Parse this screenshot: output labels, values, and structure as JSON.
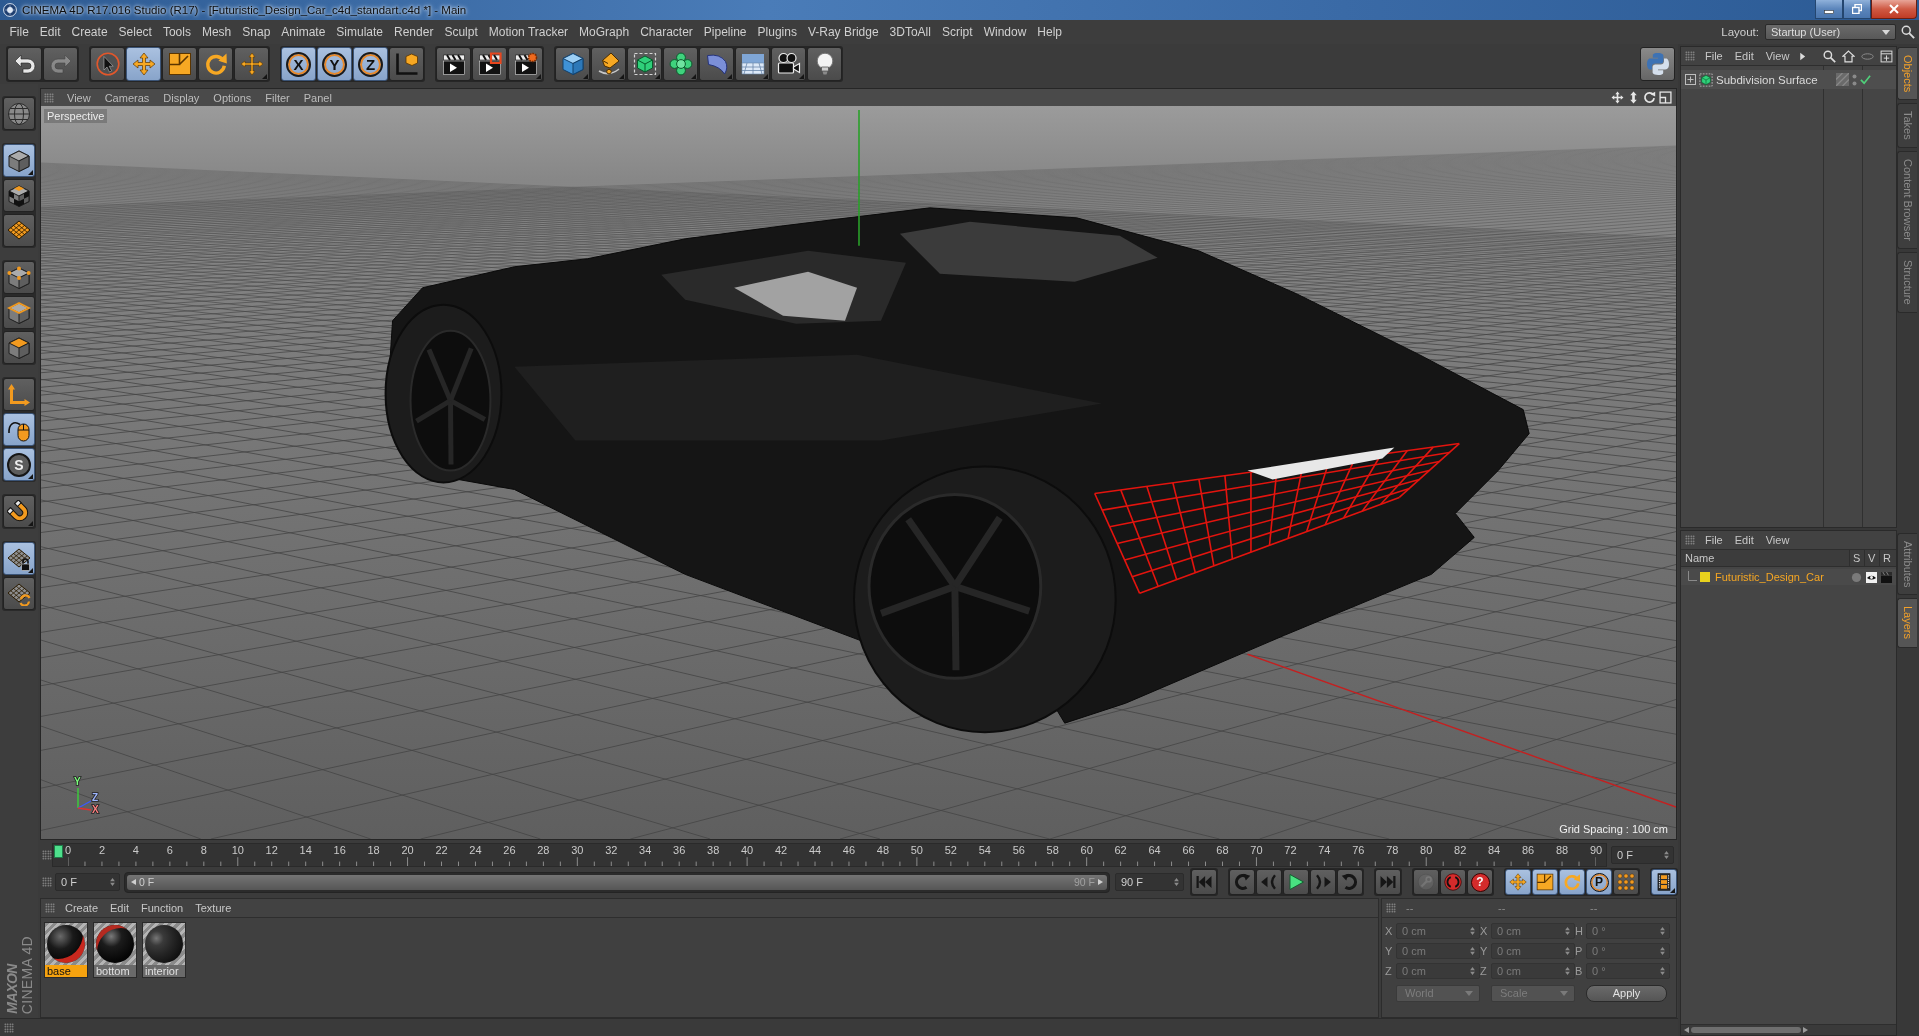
{
  "window": {
    "title": "CINEMA 4D R17.016 Studio (R17) - [Futuristic_Design_Car_c4d_standart.c4d *] - Main"
  },
  "menu_bar": {
    "items": [
      "File",
      "Edit",
      "Create",
      "Select",
      "Tools",
      "Mesh",
      "Snap",
      "Animate",
      "Simulate",
      "Render",
      "Sculpt",
      "Motion Tracker",
      "MoGraph",
      "Character",
      "Pipeline",
      "Plugins",
      "V-Ray Bridge",
      "3DToAll",
      "Script",
      "Window",
      "Help"
    ],
    "layout_label": "Layout:",
    "layout_value": "Startup (User)"
  },
  "toolbar": {
    "groups": [
      [
        {
          "kind": "undo",
          "disabled": false
        },
        {
          "kind": "redo",
          "disabled": true
        }
      ],
      [
        {
          "kind": "select",
          "selected": false
        },
        {
          "kind": "move",
          "selected": true
        },
        {
          "kind": "scale",
          "selected": false
        },
        {
          "kind": "rotate",
          "selected": false
        },
        {
          "kind": "transform",
          "selected": false
        }
      ],
      [
        {
          "kind": "axis",
          "glyph": "X",
          "selected": true
        },
        {
          "kind": "axis",
          "glyph": "Y",
          "selected": true
        },
        {
          "kind": "axis",
          "glyph": "Z",
          "selected": true
        },
        {
          "kind": "coords",
          "selected": false
        }
      ],
      [
        {
          "kind": "render"
        },
        {
          "kind": "viewer"
        },
        {
          "kind": "settings"
        }
      ],
      [
        {
          "kind": "cube"
        },
        {
          "kind": "pen"
        },
        {
          "kind": "subdivision"
        },
        {
          "kind": "cloner"
        },
        {
          "kind": "deformer"
        },
        {
          "kind": "floor"
        },
        {
          "kind": "camera"
        },
        {
          "kind": "light"
        }
      ]
    ]
  },
  "left_toolbar": {
    "groups": [
      [
        {
          "kind": "editable",
          "selected": false
        }
      ],
      [
        {
          "kind": "model",
          "selected": true
        },
        {
          "kind": "texture",
          "selected": false
        },
        {
          "kind": "workplane",
          "selected": false
        }
      ],
      [
        {
          "kind": "points",
          "selected": false
        },
        {
          "kind": "edges",
          "selected": false
        },
        {
          "kind": "polygons",
          "selected": false
        }
      ],
      [
        {
          "kind": "axismode",
          "selected": false
        },
        {
          "kind": "tweak",
          "selected": true
        },
        {
          "kind": "solo",
          "glyph": "S",
          "selected": true
        }
      ],
      [
        {
          "kind": "snap",
          "selected": false
        }
      ],
      [
        {
          "kind": "planelock",
          "selected": true
        },
        {
          "kind": "planesync",
          "selected": false
        }
      ]
    ]
  },
  "viewport": {
    "menu": [
      "View",
      "Cameras",
      "Display",
      "Options",
      "Filter",
      "Panel"
    ],
    "camera_label": "Perspective",
    "grid_spacing": "Grid Spacing : 100 cm",
    "axis_labels": [
      "Y",
      "Z",
      "X"
    ]
  },
  "timeline": {
    "ruler_labels": [
      "0",
      "2",
      "4",
      "6",
      "8",
      "10",
      "12",
      "14",
      "16",
      "18",
      "20",
      "22",
      "24",
      "26",
      "28",
      "30",
      "32",
      "34",
      "36",
      "38",
      "40",
      "42",
      "44",
      "46",
      "48",
      "50",
      "52",
      "54",
      "56",
      "58",
      "60",
      "62",
      "64",
      "66",
      "68",
      "70",
      "72",
      "74",
      "76",
      "78",
      "80",
      "82",
      "84",
      "86",
      "88",
      "90"
    ],
    "level": 0,
    "current_frame": "0 F",
    "start_frame": "0 F",
    "range": {
      "start": "0 F",
      "end": "90 F",
      "level": 1
    },
    "end_frame": "90 F",
    "transport": [
      [
        {
          "kind": "first"
        }
      ],
      [
        {
          "kind": "prevkey"
        },
        {
          "kind": "prevframe"
        },
        {
          "kind": "play"
        },
        {
          "kind": "nextframe"
        },
        {
          "kind": "nextkey"
        }
      ],
      [
        {
          "kind": "last"
        }
      ]
    ],
    "record": [
      {
        "kind": "keyframe",
        "disabled": true
      },
      {
        "kind": "autokey",
        "disabled": false
      },
      {
        "kind": "keyset",
        "glyph": "?",
        "disabled": false
      }
    ],
    "key_tracks": [
      {
        "kind": "position",
        "on": true
      },
      {
        "kind": "scale",
        "on": true
      },
      {
        "kind": "rotation",
        "on": true
      },
      {
        "kind": "parameter",
        "glyph": "P",
        "on": true
      },
      {
        "kind": "pla",
        "on": false
      }
    ],
    "timeline_button": {
      "on": true
    }
  },
  "material_manager": {
    "menu": [
      "Create",
      "Edit",
      "Function",
      "Texture"
    ],
    "materials": [
      {
        "name": "base",
        "kind": "accent",
        "selected": true
      },
      {
        "name": "bottom",
        "kind": "gloss",
        "selected": false
      },
      {
        "name": "interior",
        "kind": "camo",
        "selected": false
      }
    ]
  },
  "coordinates": {
    "disabled": true,
    "headers": [
      "--",
      "--",
      "--"
    ],
    "rows": [
      {
        "position_axis": "X",
        "position": "0 cm",
        "size_axis": "X",
        "size": "0 cm",
        "rotation_axis": "H",
        "rotation": "0 °"
      },
      {
        "position_axis": "Y",
        "position": "0 cm",
        "size_axis": "Y",
        "size": "0 cm",
        "rotation_axis": "P",
        "rotation": "0 °"
      },
      {
        "position_axis": "Z",
        "position": "0 cm",
        "size_axis": "Z",
        "size": "0 cm",
        "rotation_axis": "B",
        "rotation": "0 °"
      }
    ],
    "dropdowns": [
      "World",
      "Scale"
    ],
    "apply": "Apply"
  },
  "object_manager": {
    "menu": [
      "File",
      "Edit",
      "View"
    ],
    "objects": [
      {
        "name": "Subdivision Surface",
        "expanded": false,
        "enabled": true
      }
    ]
  },
  "layer_manager": {
    "menu": [
      "File",
      "Edit",
      "View"
    ],
    "columns": [
      "Name",
      "S",
      "V",
      "R"
    ],
    "layers": [
      {
        "name": "Futuristic_Design_Car",
        "color": "#e8d21d"
      }
    ]
  },
  "side_tabs": {
    "top": [
      {
        "label": "Objects",
        "selected": true
      },
      {
        "label": "Takes",
        "selected": false
      },
      {
        "label": "Content Browser",
        "selected": false
      },
      {
        "label": "Structure",
        "selected": false
      }
    ],
    "bottom": [
      {
        "label": "Attributes",
        "selected": false
      },
      {
        "label": "Layers",
        "selected": true
      }
    ]
  },
  "brand": {
    "company": "MAXON",
    "product": "CINEMA 4D"
  }
}
